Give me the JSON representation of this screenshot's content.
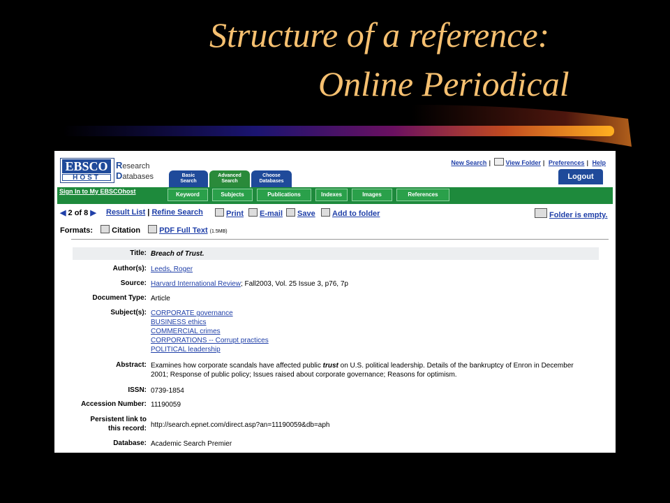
{
  "slide": {
    "title_line1": "Structure of a reference:",
    "title_line2": "Online Periodical"
  },
  "header": {
    "logo_top": "EBSCO",
    "logo_bottom": "HOST",
    "brand_line1": "esearch",
    "brand_cap1": "R",
    "brand_line2": "atabases",
    "brand_cap2": "D",
    "tabs": [
      {
        "line1": "Basic",
        "line2": "Search"
      },
      {
        "line1": "Advanced",
        "line2": "Search"
      },
      {
        "line1": "Choose",
        "line2": "Databases"
      }
    ],
    "links": {
      "new_search": "New Search",
      "view_folder": "View Folder",
      "preferences": "Preferences",
      "help": "Help",
      "sep": "|"
    },
    "logout": "Logout",
    "sign_in": "Sign In to My EBSCOhost",
    "subtabs": [
      "Keyword",
      "Subjects",
      "Publications",
      "Indexes",
      "Images",
      "References"
    ]
  },
  "nav": {
    "position": "2 of 8",
    "result_list": "Result List",
    "sep": "|",
    "refine": "Refine Search",
    "print": "Print",
    "email": "E-mail",
    "save": "Save",
    "add_folder": "Add to folder",
    "folder_status": "Folder is empty."
  },
  "formats": {
    "label": "Formats:",
    "citation": "Citation",
    "pdf": "PDF Full Text",
    "pdf_size": "(1.5MB)"
  },
  "record": {
    "title_label": "Title:",
    "title": "Breach of Trust.",
    "author_label": "Author(s):",
    "author": "Leeds, Roger",
    "source_label": "Source:",
    "source_link": "Harvard International Review",
    "source_rest": "; Fall2003, Vol. 25 Issue 3, p76, 7p",
    "doctype_label": "Document Type:",
    "doctype": "Article",
    "subjects_label": "Subject(s):",
    "subjects": [
      "CORPORATE governance",
      "BUSINESS ethics",
      "COMMERCIAL crimes",
      "CORPORATIONS -- Corrupt practices",
      "POLITICAL leadership"
    ],
    "abstract_label": "Abstract:",
    "abstract_pre": "Examines how corporate scandals have affected public ",
    "abstract_em": "trust",
    "abstract_post": " on U.S. political leadership. Details of the bankruptcy of Enron in December 2001; Response of public policy; Issues raised about corporate governance; Reasons for optimism.",
    "issn_label": "ISSN:",
    "issn": "0739-1854",
    "accession_label": "Accession Number:",
    "accession": "11190059",
    "link_label_1": "Persistent link to",
    "link_label_2": "this record:",
    "link": "http://search.epnet.com/direct.asp?an=11190059&db=aph",
    "database_label": "Database:",
    "database": "Academic Search Premier"
  }
}
